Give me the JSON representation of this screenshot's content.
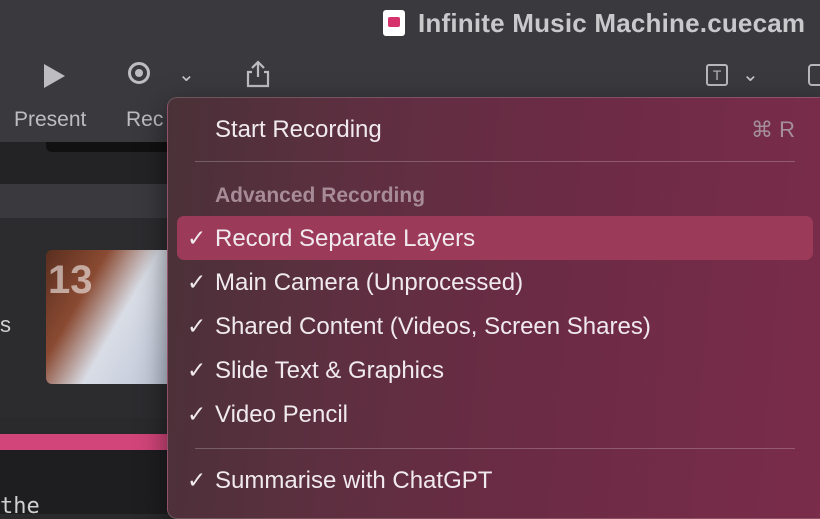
{
  "window": {
    "title": "Infinite Music Machine.cuecam"
  },
  "toolbar": {
    "present_label": "Present",
    "record_label": "Rec",
    "text_icon_glyph": "T"
  },
  "sidebar": {
    "slide_number": "13",
    "fragment_s": "s",
    "fragment_the": "the"
  },
  "menu": {
    "start_recording": {
      "label": "Start Recording",
      "shortcut": "⌘ R"
    },
    "section_title": "Advanced Recording",
    "items": [
      {
        "label": "Record Separate Layers",
        "checked": true,
        "highlighted": true
      },
      {
        "label": "Main Camera (Unprocessed)",
        "checked": true
      },
      {
        "label": "Shared Content (Videos, Screen Shares)",
        "checked": true
      },
      {
        "label": "Slide Text & Graphics",
        "checked": true
      },
      {
        "label": "Video Pencil",
        "checked": true
      }
    ],
    "summarise": {
      "label": "Summarise with ChatGPT",
      "checked": true
    },
    "check_glyph": "✓"
  },
  "colors": {
    "accent_pink": "#d2457a",
    "highlight": "#9c3a5a"
  }
}
